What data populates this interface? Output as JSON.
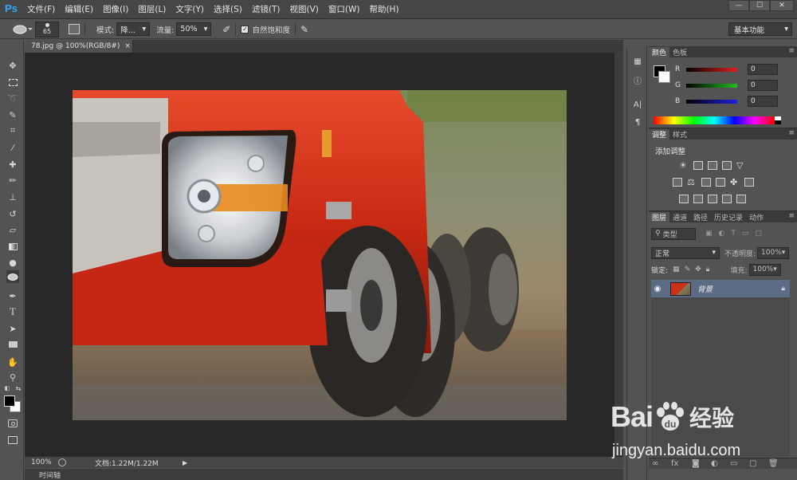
{
  "app": {
    "logo": "Ps",
    "menu": [
      "文件(F)",
      "编辑(E)",
      "图像(I)",
      "图层(L)",
      "文字(Y)",
      "选择(S)",
      "滤镜(T)",
      "视图(V)",
      "窗口(W)",
      "帮助(H)"
    ],
    "window_controls": [
      "—",
      "☐",
      "✕"
    ]
  },
  "options": {
    "brush_size": "65",
    "mode_label": "模式:",
    "mode_value": "降...",
    "flow_label": "流量:",
    "flow_value": "50%",
    "vibrance_label": "自然饱和度",
    "vibrance_checked": true,
    "workspace": "基本功能"
  },
  "document": {
    "tab_title": "78.jpg @ 100%(RGB/8#)",
    "tab_close": "×",
    "zoom": "100%",
    "doc_info": "文档:1.22M/1.22M",
    "timeline_label": "时间轴"
  },
  "color_panel": {
    "tabs": [
      "颜色",
      "色板"
    ],
    "channels": [
      {
        "label": "R",
        "value": "0",
        "color": "#e02020"
      },
      {
        "label": "G",
        "value": "0",
        "color": "#20c020"
      },
      {
        "label": "B",
        "value": "0",
        "color": "#2020e0"
      }
    ]
  },
  "adjust_panel": {
    "tabs": [
      "调整",
      "样式"
    ],
    "title": "添加调整"
  },
  "layers_panel": {
    "tabs": [
      "图层",
      "通道",
      "路径",
      "历史记录",
      "动作"
    ],
    "filter_kind": "类型",
    "blend_mode": "正常",
    "opacity_label": "不透明度:",
    "opacity_value": "100%",
    "lock_label": "锁定:",
    "fill_label": "填充:",
    "fill_value": "100%",
    "layers": [
      {
        "name": "背景",
        "visible": true,
        "locked": true
      }
    ]
  },
  "watermark": {
    "brand": "Bai",
    "brand_suffix": "经验",
    "url": "jingyan.baidu.com"
  }
}
